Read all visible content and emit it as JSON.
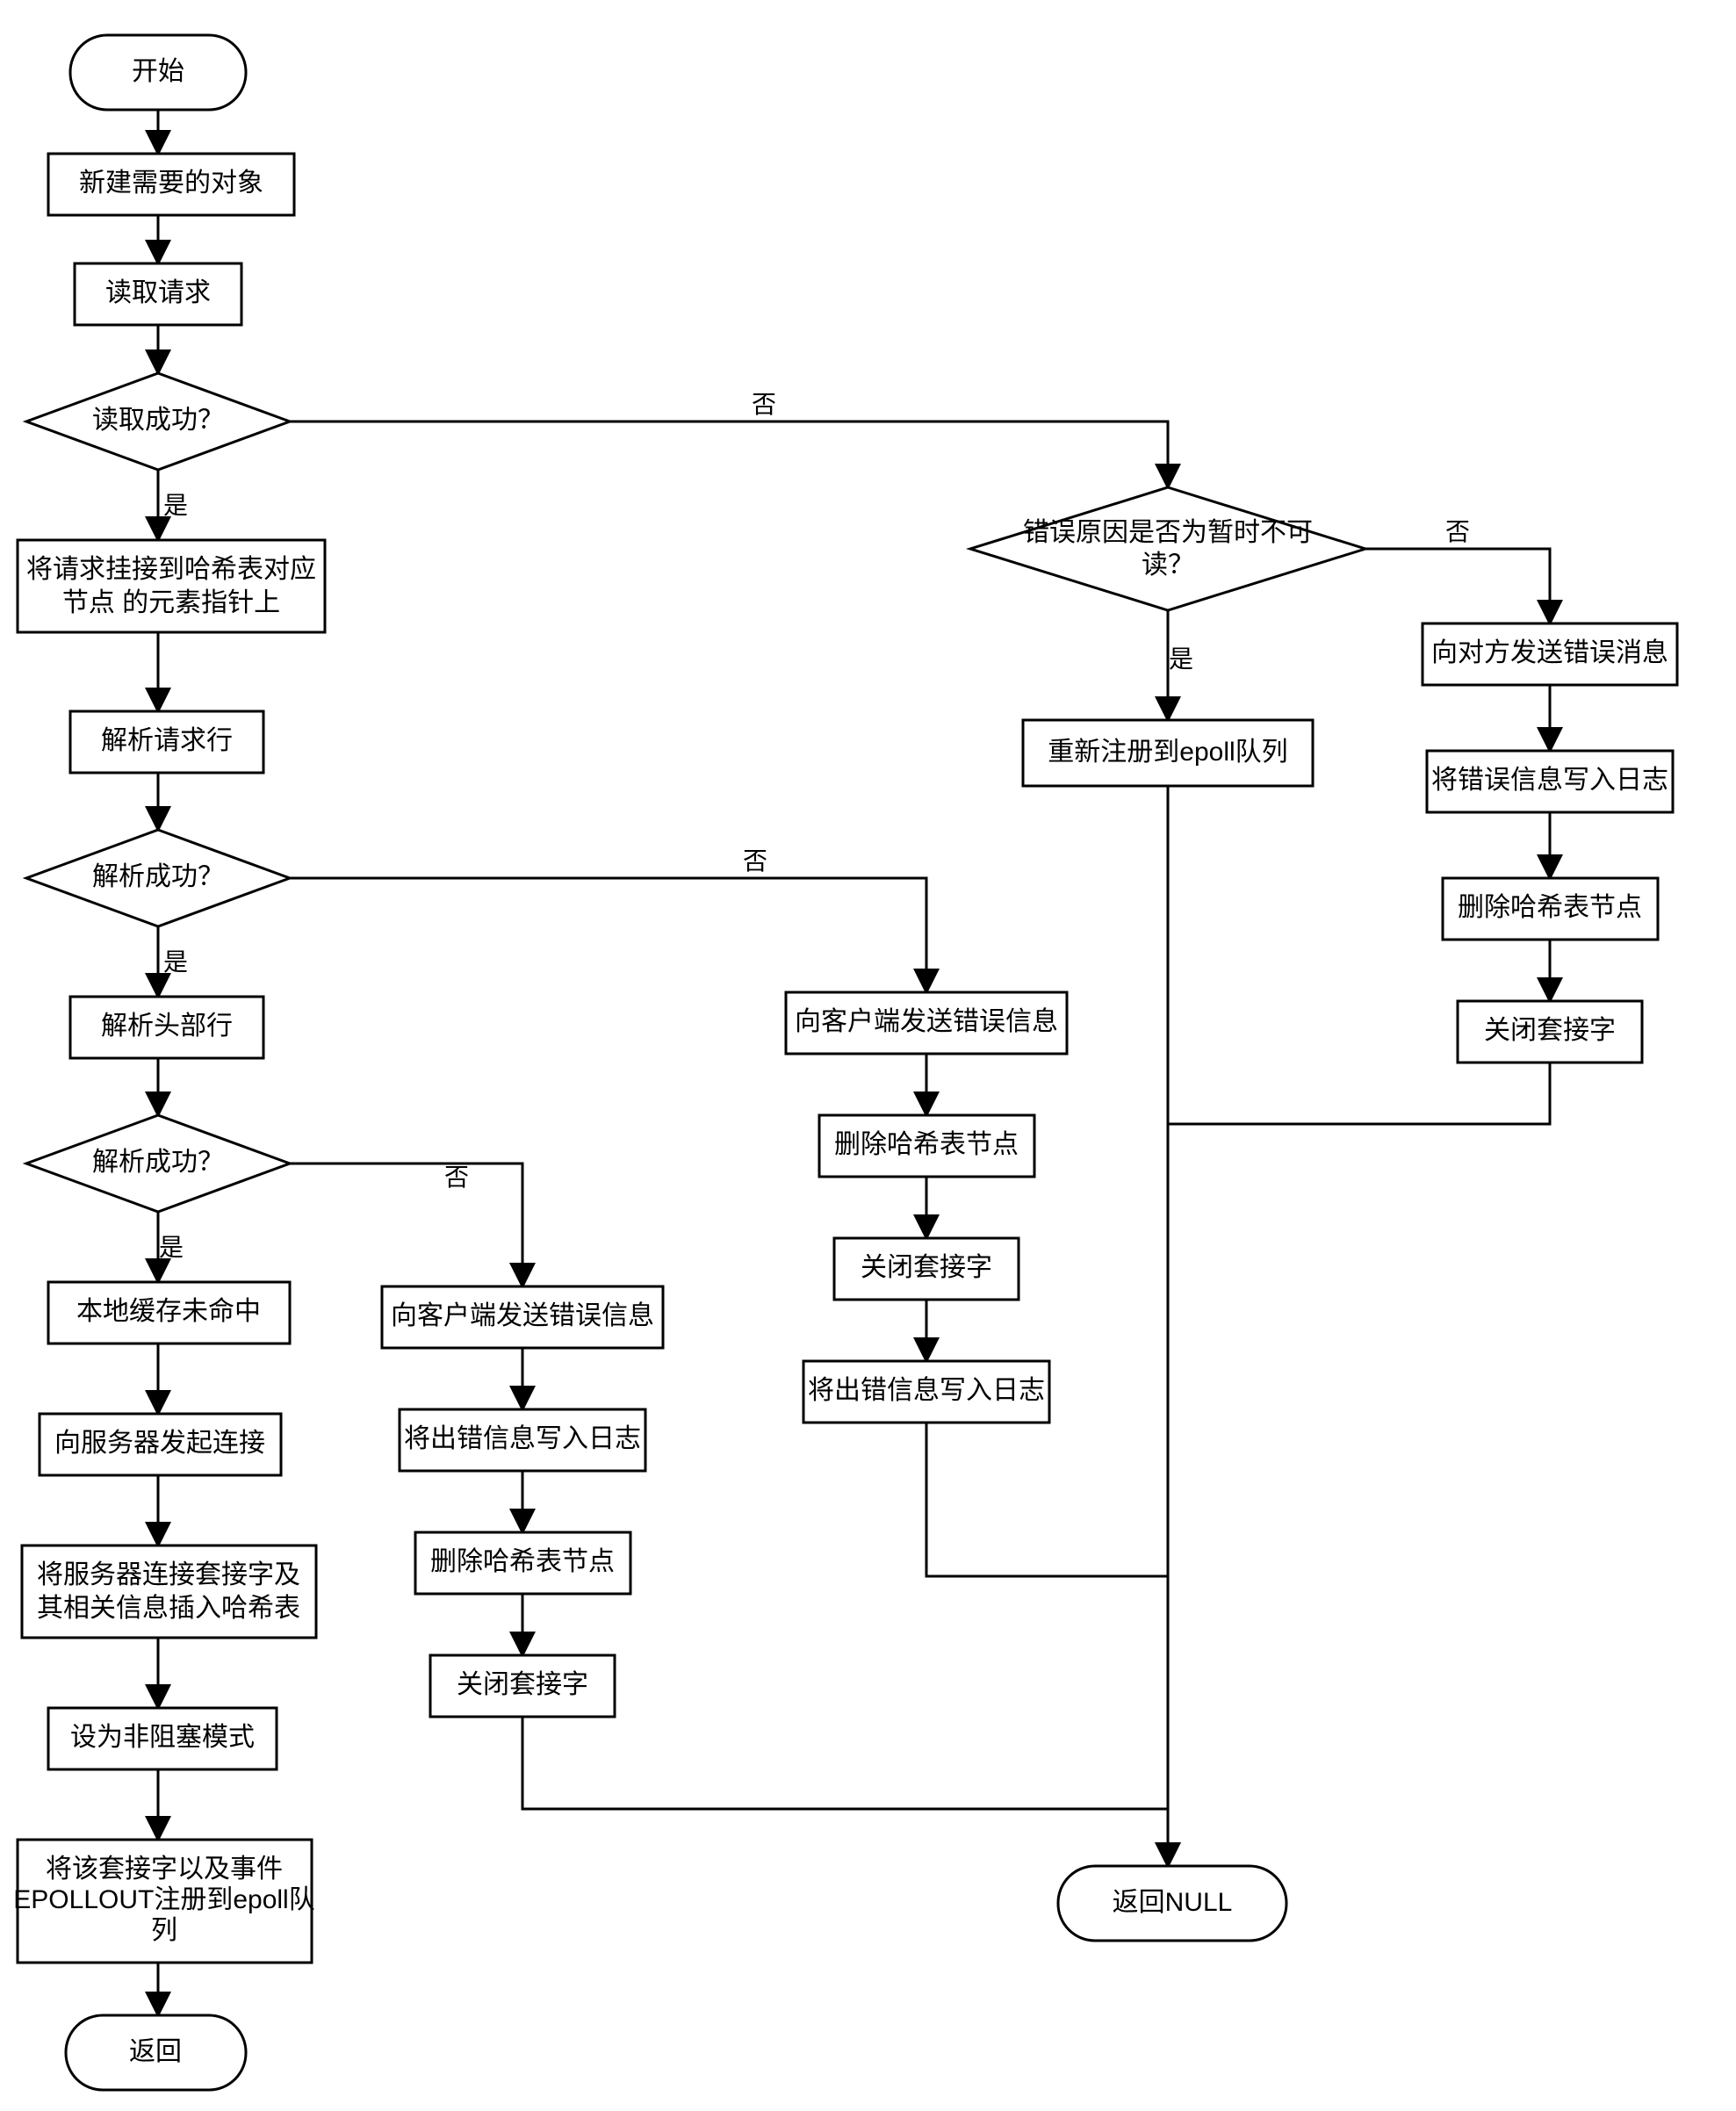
{
  "nodes": {
    "start": "开始",
    "n1": "新建需要的对象",
    "n2": "读取请求",
    "d1": "读取成功？",
    "n3a": "将请求挂接到哈希表对应",
    "n3b": "节点 的元素指针上",
    "n4": "解析请求行",
    "d2": "解析成功？",
    "n5": "解析头部行",
    "d3": "解析成功？",
    "n6": "本地缓存未命中",
    "n7": "向服务器发起连接",
    "n8a": "将服务器连接套接字及",
    "n8b": "其相关信息插入哈希表",
    "n9": "设为非阻塞模式",
    "n10a": "将该套接字以及事件",
    "n10b": "EPOLLOUT注册到epoll队",
    "n10c": "列",
    "ret": "返回",
    "r1": "向客户端发送错误信息",
    "r2": "将出错信息写入日志",
    "r3": "删除哈希表节点",
    "r4": "关闭套接字",
    "m1": "向客户端发送错误信息",
    "m2": "删除哈希表节点",
    "m3": "关闭套接字",
    "m4": "将出错信息写入日志",
    "d4a": "错误原因是否为暂时不可",
    "d4b": "读？",
    "t1": "重新注册到epoll队列",
    "e1": "向对方发送错误消息",
    "e2": "将错误信息写入日志",
    "e3": "删除哈希表节点",
    "e4": "关闭套接字",
    "retnull": "返回NULL"
  },
  "labels": {
    "yes": "是",
    "no": "否"
  }
}
